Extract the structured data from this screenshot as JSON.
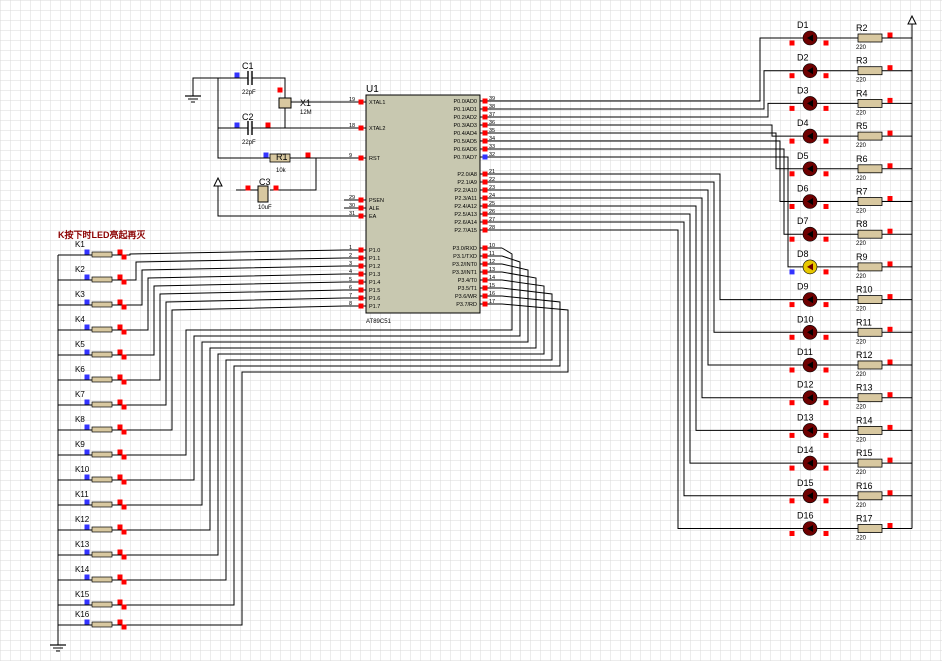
{
  "colors": {
    "background": "#ffffff",
    "grid": "#d8d8d8",
    "wire": "#000000",
    "ic_body": "#c8c8b0",
    "component_body": "#d8c8a0",
    "led_off": "#6e0000",
    "led_on": "#e8c800",
    "pin_red": "#ff0000",
    "pin_blue": "#3333ff",
    "label": "#000000",
    "title_red": "#8b0000"
  },
  "title_note": "K按下时LED亮起再灭",
  "mcu": {
    "ref": "U1",
    "part": "AT89C51",
    "left_pins": [
      {
        "num": "19",
        "name": "XTAL1"
      },
      {
        "num": "18",
        "name": "XTAL2"
      },
      {
        "num": "9",
        "name": "RST"
      },
      {
        "num": "29",
        "name": "PSEN"
      },
      {
        "num": "30",
        "name": "ALE"
      },
      {
        "num": "31",
        "name": "EA"
      },
      {
        "num": "1",
        "name": "P1.0"
      },
      {
        "num": "2",
        "name": "P1.1"
      },
      {
        "num": "3",
        "name": "P1.2"
      },
      {
        "num": "4",
        "name": "P1.3"
      },
      {
        "num": "5",
        "name": "P1.4"
      },
      {
        "num": "6",
        "name": "P1.5"
      },
      {
        "num": "7",
        "name": "P1.6"
      },
      {
        "num": "8",
        "name": "P1.7"
      }
    ],
    "right_pins": [
      {
        "num": "39",
        "name": "P0.0/AD0"
      },
      {
        "num": "38",
        "name": "P0.1/AD1"
      },
      {
        "num": "37",
        "name": "P0.2/AD2"
      },
      {
        "num": "36",
        "name": "P0.3/AD3"
      },
      {
        "num": "35",
        "name": "P0.4/AD4"
      },
      {
        "num": "34",
        "name": "P0.5/AD5"
      },
      {
        "num": "33",
        "name": "P0.6/AD6"
      },
      {
        "num": "32",
        "name": "P0.7/AD7"
      },
      {
        "num": "21",
        "name": "P2.0/A8"
      },
      {
        "num": "22",
        "name": "P2.1/A9"
      },
      {
        "num": "23",
        "name": "P2.2/A10"
      },
      {
        "num": "24",
        "name": "P2.3/A11"
      },
      {
        "num": "25",
        "name": "P2.4/A12"
      },
      {
        "num": "26",
        "name": "P2.5/A13"
      },
      {
        "num": "27",
        "name": "P2.6/A14"
      },
      {
        "num": "28",
        "name": "P2.7/A15"
      },
      {
        "num": "10",
        "name": "P3.0/RXD"
      },
      {
        "num": "11",
        "name": "P3.1/TXD"
      },
      {
        "num": "12",
        "name": "P3.2/INT0"
      },
      {
        "num": "13",
        "name": "P3.3/INT1"
      },
      {
        "num": "14",
        "name": "P3.4/T0"
      },
      {
        "num": "15",
        "name": "P3.5/T1"
      },
      {
        "num": "16",
        "name": "P3.6/WR"
      },
      {
        "num": "17",
        "name": "P3.7/RD"
      }
    ]
  },
  "oscillator": {
    "c1": {
      "ref": "C1",
      "value": "22pF"
    },
    "c2": {
      "ref": "C2",
      "value": "22pF"
    },
    "x1": {
      "ref": "X1",
      "value": "12M"
    }
  },
  "reset": {
    "r1": {
      "ref": "R1",
      "value": "10k"
    },
    "c3": {
      "ref": "C3",
      "value": "10uF"
    }
  },
  "switches": [
    "K1",
    "K2",
    "K3",
    "K4",
    "K5",
    "K6",
    "K7",
    "K8",
    "K9",
    "K10",
    "K11",
    "K12",
    "K13",
    "K14",
    "K15",
    "K16"
  ],
  "leds": [
    {
      "ref": "D1",
      "lit": false
    },
    {
      "ref": "D2",
      "lit": false
    },
    {
      "ref": "D3",
      "lit": false
    },
    {
      "ref": "D4",
      "lit": false
    },
    {
      "ref": "D5",
      "lit": false
    },
    {
      "ref": "D6",
      "lit": false
    },
    {
      "ref": "D7",
      "lit": false
    },
    {
      "ref": "D8",
      "lit": true
    },
    {
      "ref": "D9",
      "lit": false
    },
    {
      "ref": "D10",
      "lit": false
    },
    {
      "ref": "D11",
      "lit": false
    },
    {
      "ref": "D12",
      "lit": false
    },
    {
      "ref": "D13",
      "lit": false
    },
    {
      "ref": "D14",
      "lit": false
    },
    {
      "ref": "D15",
      "lit": false
    },
    {
      "ref": "D16",
      "lit": false
    }
  ],
  "resistors": [
    {
      "ref": "R2",
      "value": "220"
    },
    {
      "ref": "R3",
      "value": "220"
    },
    {
      "ref": "R4",
      "value": "220"
    },
    {
      "ref": "R5",
      "value": "220"
    },
    {
      "ref": "R6",
      "value": "220"
    },
    {
      "ref": "R7",
      "value": "220"
    },
    {
      "ref": "R8",
      "value": "220"
    },
    {
      "ref": "R9",
      "value": "220"
    },
    {
      "ref": "R10",
      "value": "220"
    },
    {
      "ref": "R11",
      "value": "220"
    },
    {
      "ref": "R12",
      "value": "220"
    },
    {
      "ref": "R13",
      "value": "220"
    },
    {
      "ref": "R14",
      "value": "220"
    },
    {
      "ref": "R15",
      "value": "220"
    },
    {
      "ref": "R16",
      "value": "220"
    },
    {
      "ref": "R17",
      "value": "220"
    }
  ]
}
